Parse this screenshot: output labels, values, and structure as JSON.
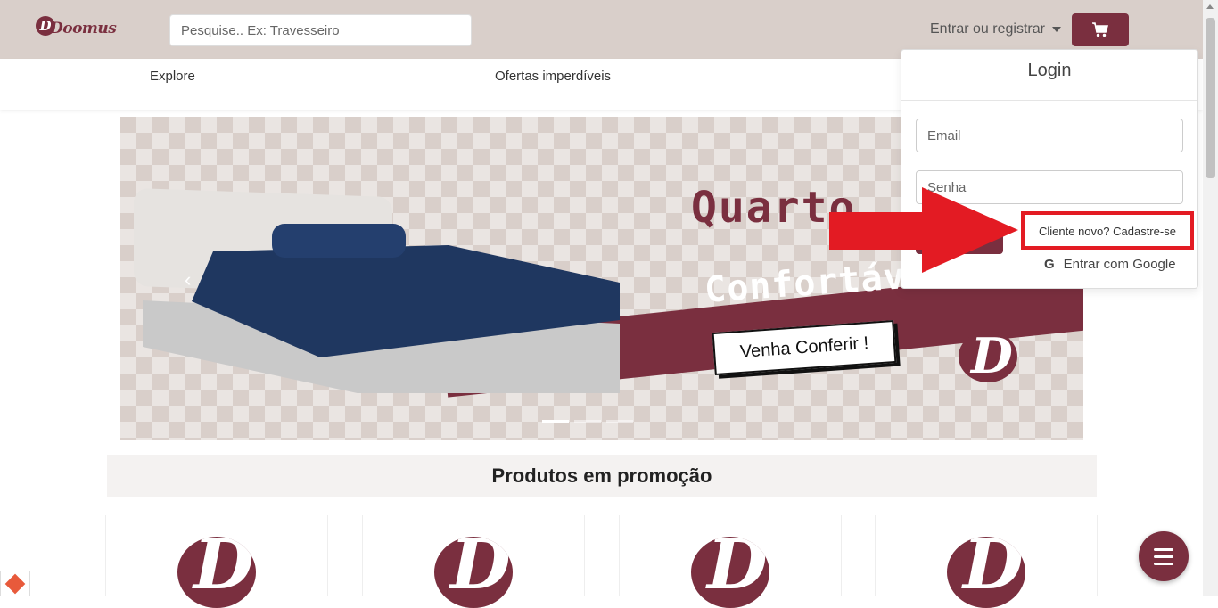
{
  "header": {
    "logo_text": "Doomus",
    "search_placeholder": "Pesquise.. Ex: Travesseiro",
    "login_toggle": "Entrar ou registrar",
    "cart_icon": "cart-icon"
  },
  "nav": {
    "items": [
      {
        "label": "Explore"
      },
      {
        "label": "Ofertas imperdíveis"
      }
    ]
  },
  "banner": {
    "line1": "Quarto",
    "line2": "Confortáv",
    "cta": "Venha Conferir !",
    "logo_letter": "D"
  },
  "promo": {
    "title": "Produtos em promoção",
    "card_logo_letter": "D"
  },
  "login_dropdown": {
    "title": "Login",
    "email_placeholder": "Email",
    "password_placeholder": "Senha",
    "register_link": "Cliente novo? Cadastre-se",
    "google_icon_letter": "G",
    "google_link": "Entrar com Google"
  },
  "colors": {
    "brand": "#7a2f3f",
    "header_bg": "#d9cfca",
    "annotation_red": "#e31b23"
  }
}
